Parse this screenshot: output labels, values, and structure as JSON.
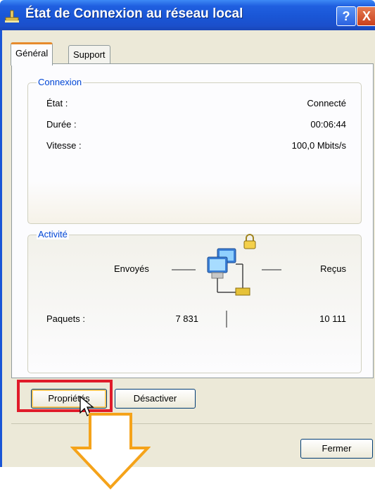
{
  "window": {
    "title": "État de Connexion au réseau local",
    "help_label": "?",
    "close_label": "X"
  },
  "tabs": [
    {
      "label": "Général",
      "selected": true
    },
    {
      "label": "Support",
      "selected": false
    }
  ],
  "connexion": {
    "group_label": "Connexion",
    "rows": [
      {
        "label": "État :",
        "value": "Connecté"
      },
      {
        "label": "Durée :",
        "value": "00:06:44"
      },
      {
        "label": "Vitesse :",
        "value": "100,0 Mbits/s"
      }
    ]
  },
  "activite": {
    "group_label": "Activité",
    "sent_label": "Envoyés",
    "received_label": "Reçus",
    "packets_label": "Paquets :",
    "packets_sent": "7 831",
    "packets_received": "10 111"
  },
  "buttons": {
    "properties": "Propriétés",
    "disable": "Désactiver",
    "close": "Fermer"
  },
  "colors": {
    "title_bar": "#1a56d6",
    "group_label": "#0046d5",
    "highlight": "#e01b2a",
    "arrow": "#f5a31a"
  },
  "icons": [
    "network-connection-icon",
    "network-computers-icon",
    "lock-icon",
    "mouse-pointer-icon",
    "down-arrow-annotation"
  ]
}
